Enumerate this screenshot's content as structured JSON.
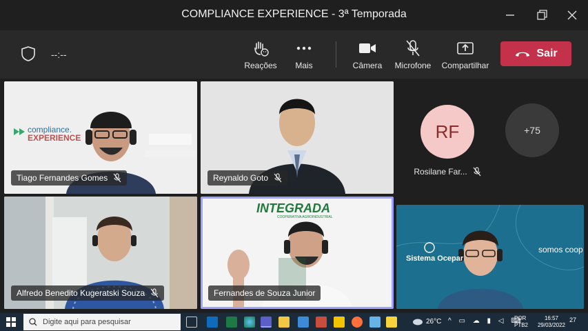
{
  "window": {
    "title": "COMPLIANCE EXPERIENCE - 3ª Temporada"
  },
  "toolbar": {
    "timer": "--:--",
    "reactions_label": "Reações",
    "more_label": "Mais",
    "camera_label": "Câmera",
    "mic_label": "Microfone",
    "share_label": "Compartilhar",
    "leave_label": "Sair",
    "leave_color": "#c4314b"
  },
  "participants": [
    {
      "name": "Tiago Fernandes Gomes",
      "muted": true,
      "logo_text": "compliance.",
      "logo_text2": "EXPERIENCE"
    },
    {
      "name": "Reynaldo Goto",
      "muted": true
    },
    {
      "name": "Alfredo Benedito Kugeratski Souza",
      "muted": true
    },
    {
      "name": "Fernandes de Souza Junior",
      "muted": false,
      "active": true,
      "banner": "INTEGRADA",
      "banner_sub": "COOPERATIVA AGROINDUSTRIAL"
    },
    {
      "name": "",
      "banner": "Sistema Ocepar",
      "logo": "somos coop"
    }
  ],
  "roster": {
    "first": {
      "initials": "RF",
      "name": "Rosilane Far...",
      "muted": true
    },
    "overflow": "+75"
  },
  "taskbar": {
    "search_placeholder": "Digite aqui para pesquisar",
    "weather": "26°C",
    "lang1": "POR",
    "lang2": "PTB2",
    "time": "16:57",
    "date": "29/03/2022",
    "notif_count": "27"
  }
}
